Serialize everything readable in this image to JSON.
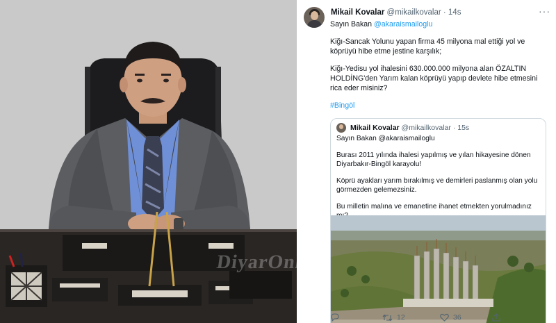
{
  "photo": {
    "watermark": "DiyarOnline"
  },
  "tweet": {
    "author_name": "Mikail Kovalar",
    "author_handle": "@mikailkovalar",
    "time": "· 14s",
    "greeting_prefix": "Sayın Bakan ",
    "mention": "@akaraismailoglu",
    "paragraph1": "Kiğı-Sancak Yolunu yapan firma 45 milyona mal ettiği yol ve köprüyü hibe etme jestine karşılık;",
    "paragraph2": "Kiğı-Yedisu yol ihalesini 630.000.000 milyona alan ÖZALTIN HOLDİNG'den Yarım kalan köprüyü yapıp devlete hibe etmesini rica eder misiniz?",
    "hashtag": "#Bingöl"
  },
  "quote": {
    "author_name": "Mikail Kovalar",
    "author_handle": "@mikailkovalar",
    "time": "· 15s",
    "line1": "Sayın Bakan @akaraismailoglu",
    "paragraph1": "Burası 2011 yılında ihalesi yapılmış ve yılan hikayesine dönen Diyarbakır-Bingöl karayolu!",
    "paragraph2": "Köprü ayakları yarım bırakılmış ve demirleri paslanmış olan yolu görmezden gelemezsiniz.",
    "paragraph3": "Bu milletin malına ve emanetine ihanet etmekten yorulmadınız mı?"
  },
  "actions": {
    "reply_count": "",
    "retweet_count": "12",
    "like_count": "36"
  },
  "colors": {
    "link": "#1d9bf0",
    "secondary_text": "#536471",
    "border": "#cfd9de"
  }
}
